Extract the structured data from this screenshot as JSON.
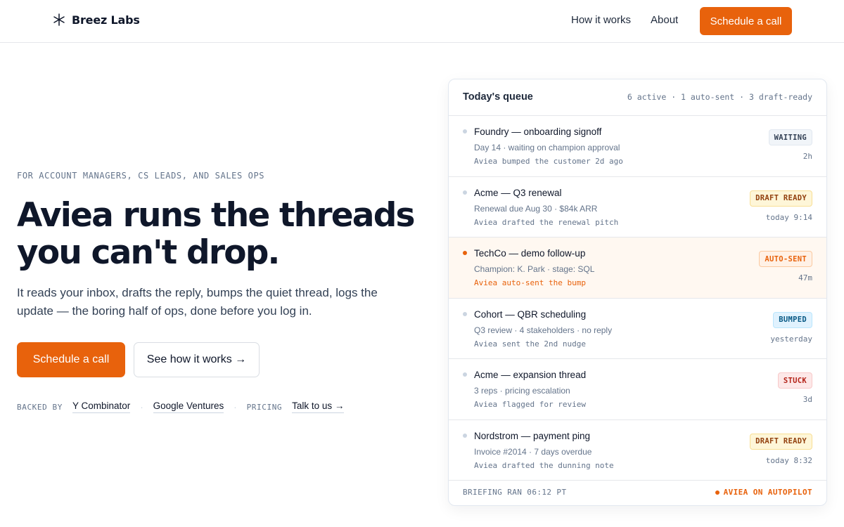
{
  "nav": {
    "brand": "Breez Labs",
    "links": [
      "How it works",
      "About"
    ],
    "cta": "Schedule a call"
  },
  "hero": {
    "eyebrow": "FOR ACCOUNT MANAGERS, CS LEADS, AND SALES OPS",
    "headline_line1": "Aviea runs the threads",
    "headline_line2": "you can't drop.",
    "subtext": "It reads your inbox, drafts the reply, bumps the quiet thread, logs the update — the boring half of ops, done before you log in.",
    "primary_cta": "Schedule a call",
    "secondary_cta": "See how it works →",
    "backed_label": "BACKED BY",
    "backers": [
      "Y Combinator",
      "Google Ventures"
    ],
    "pricing_label": "PRICING",
    "pricing_link": "Talk to us →"
  },
  "queue": {
    "title": "Today's queue",
    "meta": "6 active · 1 auto-sent · 3 draft-ready",
    "rows": [
      {
        "title": "Foundry — onboarding signoff",
        "detail": "Day 14 · waiting on champion approval",
        "action": "Aviea bumped the customer 2d ago",
        "badge": "WAITING",
        "time": "2h"
      },
      {
        "title": "Acme — Q3 renewal",
        "detail": "Renewal due Aug 30 · $84k ARR",
        "action": "Aviea drafted the renewal pitch",
        "badge": "DRAFT READY",
        "time": "today 9:14"
      },
      {
        "title": "TechCo — demo follow-up",
        "detail": "Champion: K. Park · stage: SQL",
        "action": "Aviea auto-sent the bump",
        "badge": "AUTO-SENT",
        "time": "47m"
      },
      {
        "title": "Cohort — QBR scheduling",
        "detail": "Q3 review · 4 stakeholders · no reply",
        "action": "Aviea sent the 2nd nudge",
        "badge": "BUMPED",
        "time": "yesterday"
      },
      {
        "title": "Acme — expansion thread",
        "detail": "3 reps · pricing escalation",
        "action": "Aviea flagged for review",
        "badge": "STUCK",
        "time": "3d"
      },
      {
        "title": "Nordstrom — payment ping",
        "detail": "Invoice #2014 · 7 days overdue",
        "action": "Aviea drafted the dunning note",
        "badge": "DRAFT READY",
        "time": "today 8:32"
      }
    ],
    "footer_left": "BRIEFING RAN 06:12 PT",
    "footer_right": "AVIEA ON AUTOPILOT"
  },
  "colors": {
    "accent": "#e8620c",
    "text": "#0f172a",
    "muted": "#64748b"
  },
  "icons": {
    "brand": "asterisk-spark-icon",
    "status": "status-dot-icon"
  }
}
